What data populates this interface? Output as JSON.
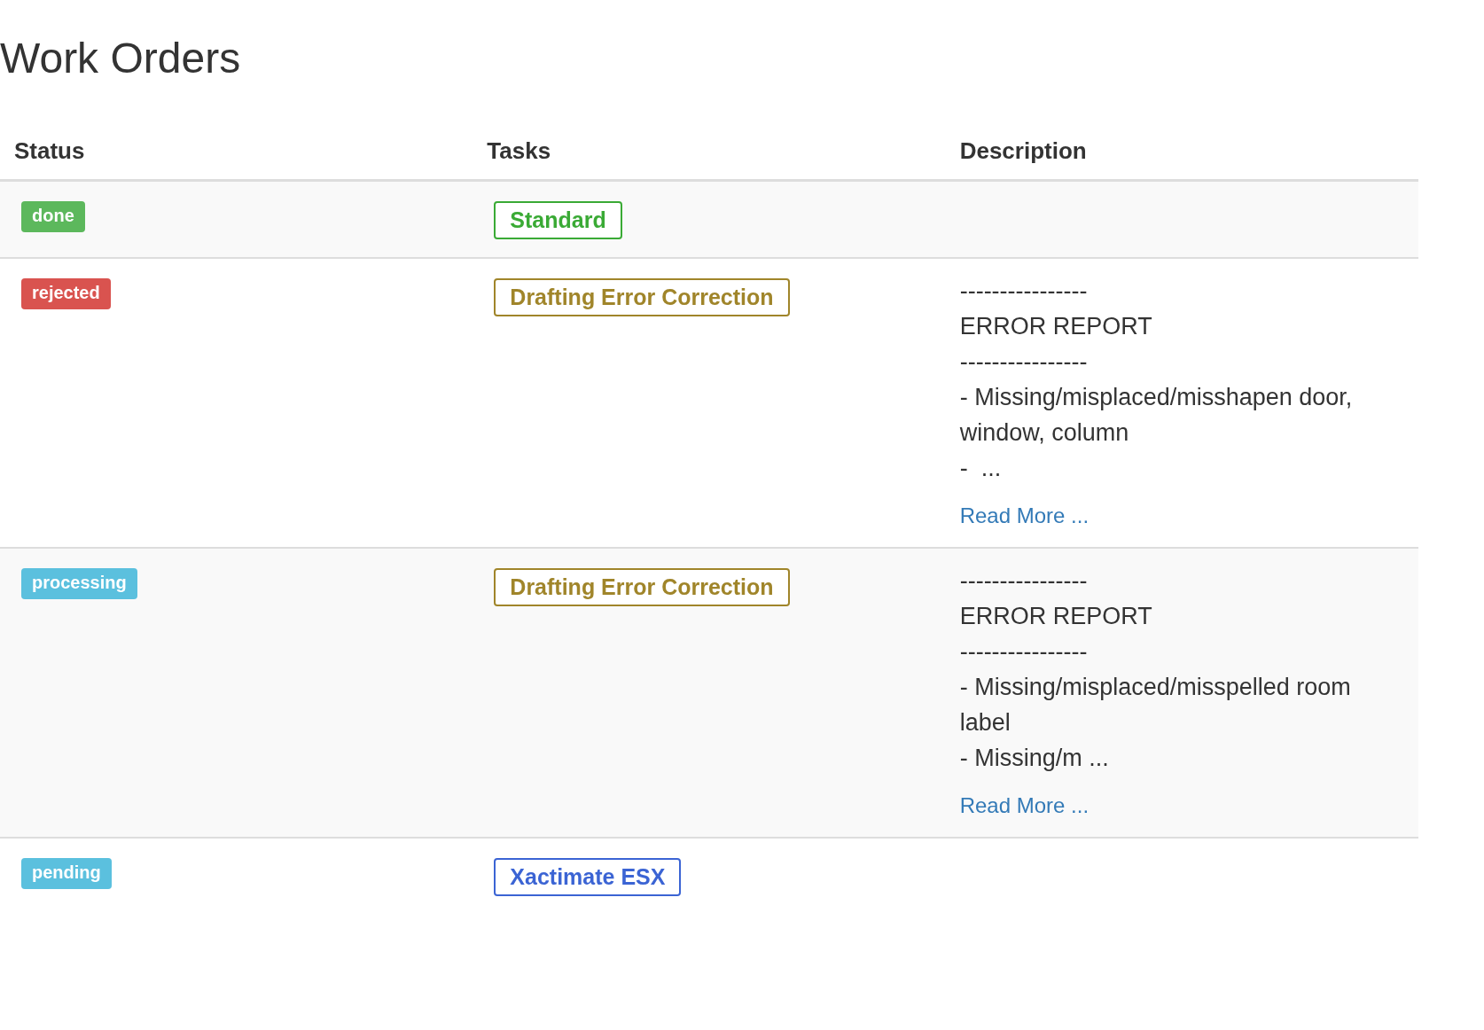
{
  "title": "Work Orders",
  "table": {
    "columns": [
      "Status",
      "Tasks",
      "Description"
    ],
    "rows": [
      {
        "status": {
          "label": "done",
          "color": "#5cb85c"
        },
        "task": {
          "label": "Standard",
          "color": "#3aaa35"
        },
        "description": [],
        "link": null
      },
      {
        "status": {
          "label": "rejected",
          "color": "#d9534f"
        },
        "task": {
          "label": "Drafting Error Correction",
          "color": "#a0852a"
        },
        "description": [
          "----------------",
          "ERROR REPORT",
          "----------------",
          "- Missing/misplaced/misshapen door, window, column",
          "-  ..."
        ],
        "link": "Read More ..."
      },
      {
        "status": {
          "label": "processing",
          "color": "#5bc0de"
        },
        "task": {
          "label": "Drafting Error Correction",
          "color": "#a0852a"
        },
        "description": [
          "----------------",
          "ERROR REPORT",
          "----------------",
          "- Missing/misplaced/misspelled room label",
          "- Missing/m ..."
        ],
        "link": "Read More ..."
      },
      {
        "status": {
          "label": "pending",
          "color": "#5bc0de"
        },
        "task": {
          "label": "Xactimate ESX",
          "color": "#3b64d4"
        },
        "description": [],
        "link": null
      }
    ]
  }
}
